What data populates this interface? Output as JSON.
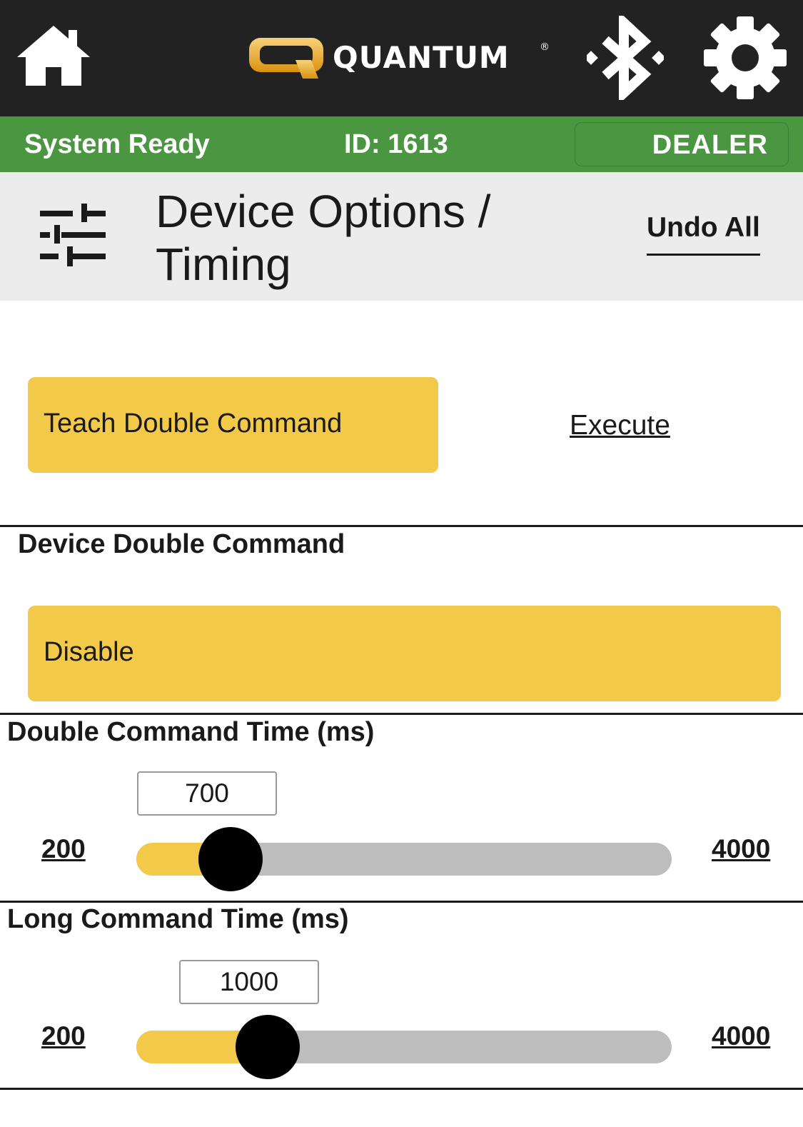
{
  "header": {
    "brand_name": "QUANTUM",
    "brand_reg": "®",
    "icons": [
      "home-icon",
      "quantum-logo-icon",
      "bluetooth-icon",
      "gear-icon"
    ],
    "background_color": "#222222"
  },
  "status": {
    "text": "System Ready",
    "id_label": "ID: 1613",
    "role_button": "DEALER",
    "background_color": "#4a9641"
  },
  "title_bar": {
    "icon": "sliders-icon",
    "title": "Device Options / Timing",
    "undo_label": "Undo All"
  },
  "actions": {
    "teach_button": "Teach Double Command",
    "execute_link": "Execute"
  },
  "device_double_command": {
    "label": "Device Double Command",
    "selected_value": "Disable"
  },
  "double_command_time": {
    "label": "Double Command Time (ms)",
    "value": 700,
    "value_text": "700",
    "min": 200,
    "min_text": "200",
    "max": 4000,
    "max_text": "4000"
  },
  "long_command_time": {
    "label": "Long Command Time (ms)",
    "value": 1000,
    "value_text": "1000",
    "min": 200,
    "min_text": "200",
    "max": 4000,
    "max_text": "4000"
  },
  "colors": {
    "accent_yellow": "#f3c94a",
    "track_gray": "#bdbdbd",
    "thumb": "#000000"
  }
}
